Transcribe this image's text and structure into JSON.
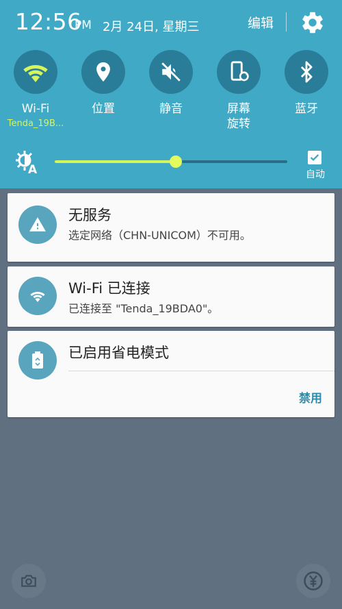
{
  "status": {
    "time": "12:56",
    "ampm": "PM",
    "date": "2月 24日, 星期三",
    "edit_label": "编辑"
  },
  "tiles": [
    {
      "label": "Wi-Fi",
      "sub": "Tenda_19B...",
      "icon": "wifi-icon",
      "active": true
    },
    {
      "label": "位置",
      "icon": "location-icon",
      "active": false
    },
    {
      "label": "静音",
      "icon": "mute-icon",
      "active": false
    },
    {
      "label": "屏幕\n旋转",
      "icon": "rotate-icon",
      "active": false
    },
    {
      "label": "蓝牙",
      "icon": "bluetooth-icon",
      "active": false
    }
  ],
  "brightness": {
    "level_percent": 52,
    "auto_label": "自动",
    "auto_checked": true
  },
  "notifications": [
    {
      "title": "无服务",
      "text": "选定网络（CHN-UNICOM）不可用。",
      "icon": "warning-icon"
    },
    {
      "title": "Wi-Fi 已连接",
      "text": "已连接至 \"Tenda_19BDA0\"。",
      "icon": "wifi-icon"
    },
    {
      "title": "已启用省电模式",
      "action": "禁用",
      "icon": "battery-saver-icon"
    }
  ],
  "shortcuts": [
    {
      "icon": "camera-icon"
    },
    {
      "icon": "wallet-icon"
    }
  ],
  "colors": {
    "panel": "#3fa9c6",
    "tile_circle": "#2a7d98",
    "accent_lime": "#d7f55a",
    "shade": "#607080"
  }
}
